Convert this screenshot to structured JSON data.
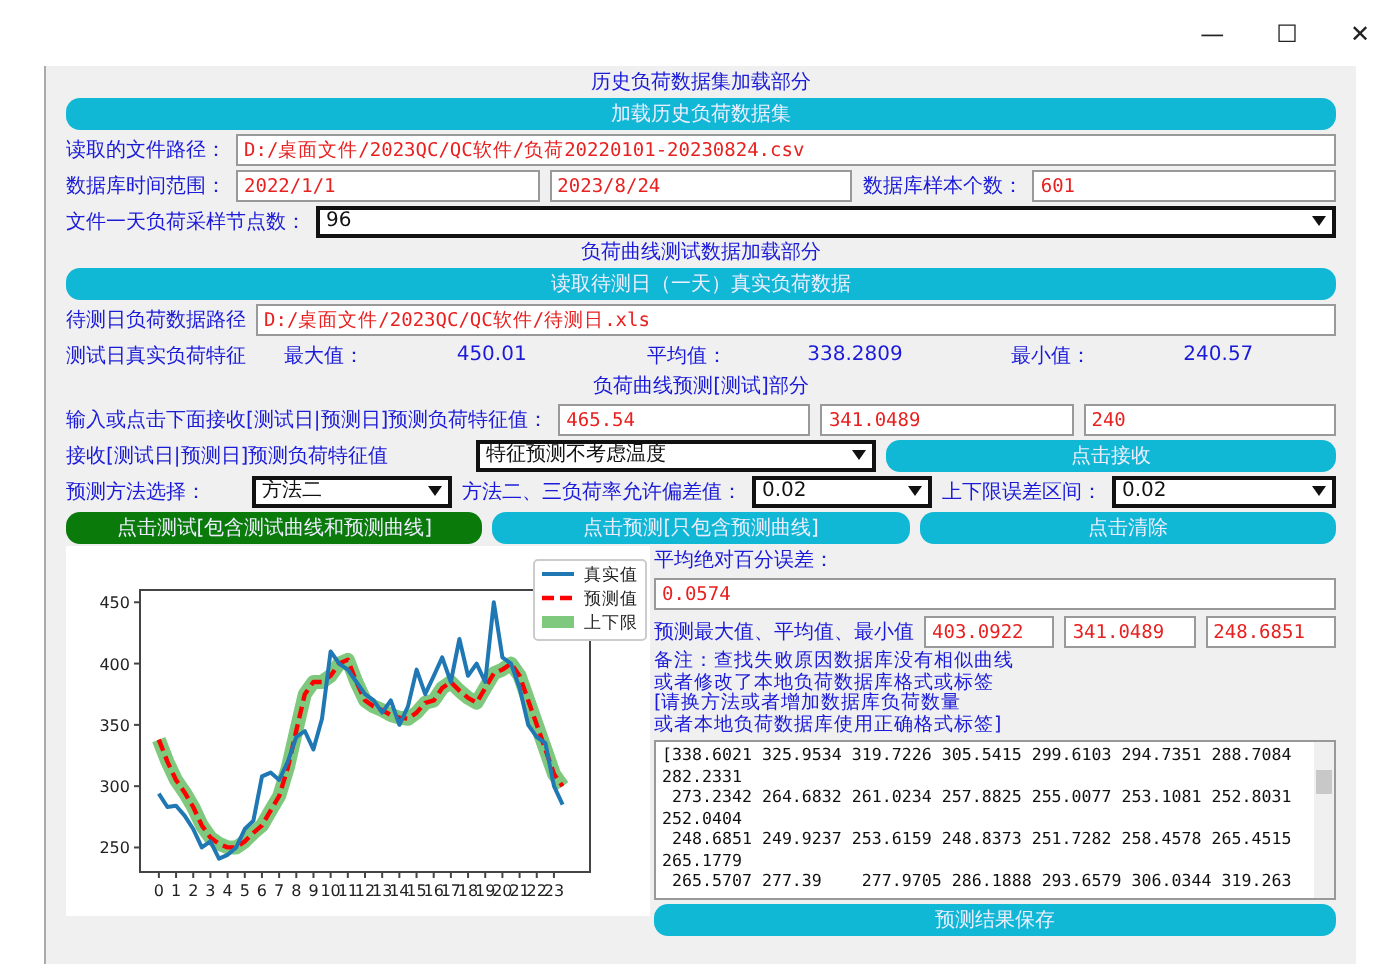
{
  "window": {
    "controls": [
      "—",
      "☐",
      "✕"
    ]
  },
  "history": {
    "heading": "历史负荷数据集加载部分",
    "load_button": "加载历史负荷数据集",
    "path_label": "读取的文件路径：",
    "path": "D:/桌面文件/2023QC/QC软件/负荷20220101-20230824.csv",
    "range_label": "数据库时间范围：",
    "range_start": "2022/1/1",
    "range_end": "2023/8/24",
    "count_label": "数据库样本个数：",
    "count": "601",
    "nodes_label": "文件一天负荷采样节点数：",
    "nodes": "96"
  },
  "test": {
    "heading": "负荷曲线测试数据加载部分",
    "read_button": "读取待测日（一天）真实负荷数据",
    "path_label": "待测日负荷数据路径",
    "path": "D:/桌面文件/2023QC/QC软件/待测日.xls",
    "stats_label": "测试日真实负荷特征",
    "stats": [
      {
        "label": "最大值：",
        "value": "450.01"
      },
      {
        "label": "平均值：",
        "value": "338.2809"
      },
      {
        "label": "最小值：",
        "value": "240.57"
      }
    ]
  },
  "forecast": {
    "heading": "负荷曲线预测[测试]部分",
    "input_label": "输入或点击下面接收[测试日|预测日]预测负荷特征值：",
    "inputs": [
      "465.54",
      "341.0489",
      "240"
    ],
    "receive_label": "接收[测试日|预测日]预测负荷特征值",
    "receive_mode": "特征预测不考虑温度",
    "receive_button": "点击接收",
    "method_label": "预测方法选择：",
    "method": "方法二",
    "tolerance_label": "方法二、三负荷率允许偏差值：",
    "tolerance": "0.02",
    "band_label": "上下限误差区间：",
    "band": "0.02",
    "buttons": [
      {
        "label": "点击测试[包含测试曲线和预测曲线]",
        "kind": "primary"
      },
      {
        "label": "点击预测[只包含预测曲线]",
        "kind": "normal"
      },
      {
        "label": "点击清除",
        "kind": "normal"
      }
    ]
  },
  "chart": {
    "chart_data": {
      "type": "line",
      "x": [
        0,
        0.5,
        1,
        1.5,
        2,
        2.5,
        3,
        3.5,
        4,
        4.5,
        5,
        5.5,
        6,
        6.5,
        7,
        7.5,
        8,
        8.5,
        9,
        9.5,
        10,
        10.5,
        11,
        11.5,
        12,
        12.5,
        13,
        13.5,
        14,
        14.5,
        15,
        15.5,
        16,
        16.5,
        17,
        17.5,
        18,
        18.5,
        19,
        19.5,
        20,
        20.5,
        21,
        21.5,
        22,
        22.5,
        23,
        23.5
      ],
      "series": [
        {
          "name": "真实值",
          "color": "#1f77b4",
          "line_style": "solid",
          "values": [
            294,
            283,
            284,
            276,
            265,
            250,
            255,
            241,
            244,
            250,
            265,
            272,
            308,
            311,
            305,
            320,
            340,
            345,
            330,
            355,
            410,
            400,
            395,
            385,
            375,
            370,
            360,
            370,
            350,
            365,
            395,
            375,
            390,
            405,
            385,
            420,
            390,
            400,
            385,
            450,
            405,
            400,
            380,
            350,
            340,
            335,
            300,
            285
          ]
        },
        {
          "name": "预测值",
          "color": "#ff0000",
          "line_style": "dashed",
          "values": [
            338,
            320,
            305,
            295,
            283,
            268,
            258,
            253,
            250,
            250,
            255,
            262,
            268,
            280,
            292,
            315,
            345,
            375,
            385,
            385,
            390,
            400,
            403,
            385,
            370,
            365,
            362,
            358,
            356,
            355,
            360,
            368,
            370,
            380,
            385,
            378,
            372,
            368,
            380,
            392,
            395,
            400,
            390,
            370,
            350,
            330,
            310,
            300
          ]
        },
        {
          "name": "上下限",
          "color": "#7fc97f",
          "line_style": "solid",
          "values": [
            338,
            320,
            305,
            295,
            283,
            268,
            258,
            253,
            250,
            250,
            255,
            262,
            268,
            280,
            292,
            315,
            345,
            375,
            385,
            385,
            390,
            400,
            403,
            385,
            370,
            365,
            362,
            358,
            356,
            355,
            360,
            368,
            370,
            380,
            385,
            378,
            372,
            368,
            380,
            392,
            395,
            400,
            390,
            370,
            350,
            330,
            310,
            300
          ]
        }
      ],
      "legend": true,
      "xlim": [
        -1.1,
        25.1
      ],
      "ylim": [
        230,
        460
      ],
      "xticks": [
        0,
        1,
        2,
        3,
        4,
        5,
        6,
        7,
        8,
        9,
        10,
        11,
        12,
        13,
        14,
        15,
        16,
        17,
        18,
        19,
        20,
        21,
        22,
        23
      ],
      "yticks": [
        250,
        300,
        350,
        400,
        450
      ]
    }
  },
  "results": {
    "mape_label": "平均绝对百分误差：",
    "mape": "0.0574",
    "pred_label": "预测最大值、平均值、最小值",
    "pred": [
      "403.0922",
      "341.0489",
      "248.6851"
    ],
    "note": [
      "备注：查找失败原因数据库没有相似曲线",
      "或者修改了本地负荷数据库格式或标签",
      "[请换方法或者增加数据库负荷数量",
      "或者本地负荷数据库使用正确格式标签]"
    ],
    "output_lines": [
      "[338.6021 325.9534 319.7226 305.5415 299.6103 294.7351 288.7084",
      "282.2331",
      " 273.2342 264.6832 261.0234 257.8825 255.0077 253.1081 252.8031",
      "252.0404",
      " 248.6851 249.9237 253.6159 248.8373 251.7282 258.4578 265.4515",
      "265.1779",
      " 265.5707 277.39    277.9705 286.1888 293.6579 306.0344 319.263"
    ],
    "save_button": "预测结果保存"
  }
}
